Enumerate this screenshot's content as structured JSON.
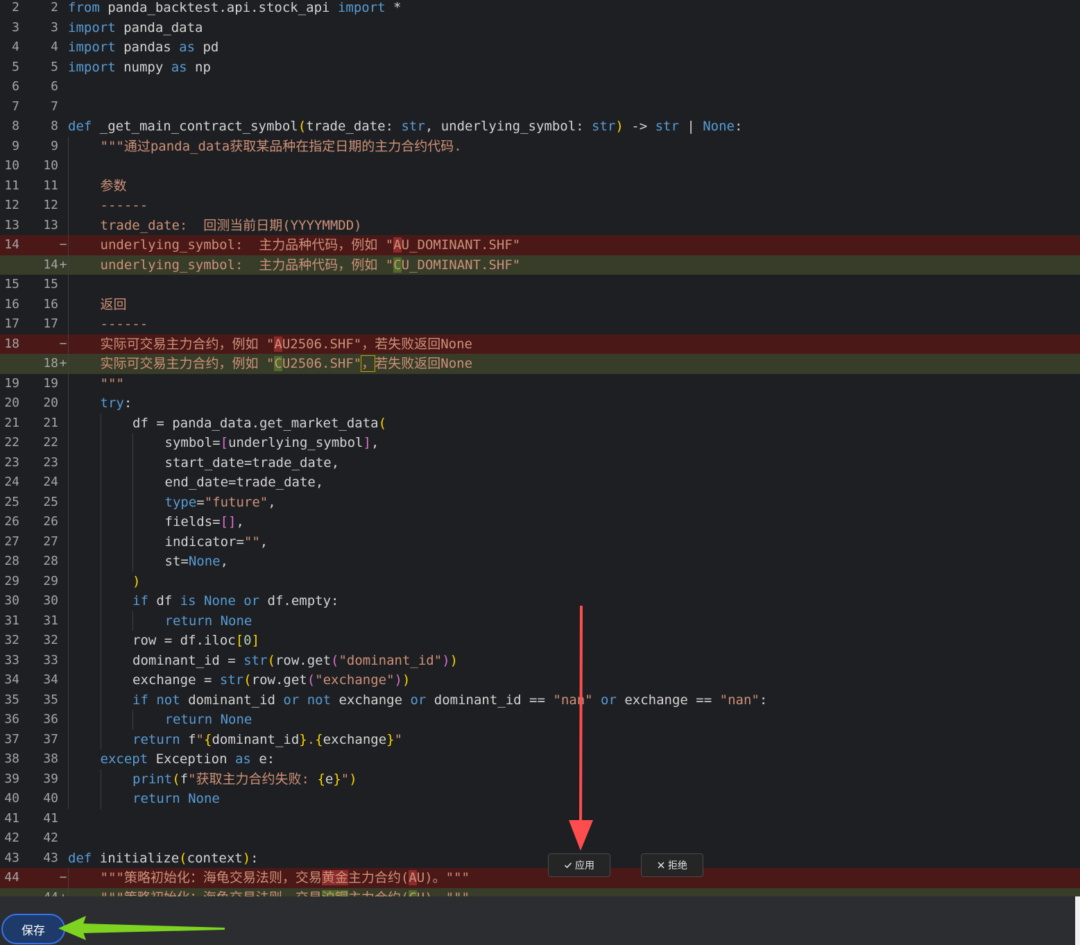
{
  "editor": {
    "lines": [
      {
        "old": "2",
        "new": "2",
        "mark": "",
        "type": "ctx",
        "indent": 0,
        "tokens": [
          [
            "from",
            "kw"
          ],
          [
            " panda_backtest.api.stock_api ",
            ""
          ],
          [
            "import",
            "kw"
          ],
          [
            " *",
            ""
          ]
        ]
      },
      {
        "old": "3",
        "new": "3",
        "mark": "",
        "type": "ctx",
        "indent": 0,
        "tokens": [
          [
            "import",
            "kw"
          ],
          [
            " panda_data",
            ""
          ]
        ]
      },
      {
        "old": "4",
        "new": "4",
        "mark": "",
        "type": "ctx",
        "indent": 0,
        "tokens": [
          [
            "import",
            "kw"
          ],
          [
            " pandas ",
            ""
          ],
          [
            "as",
            "kw"
          ],
          [
            " pd",
            ""
          ]
        ]
      },
      {
        "old": "5",
        "new": "5",
        "mark": "",
        "type": "ctx",
        "indent": 0,
        "tokens": [
          [
            "import",
            "kw"
          ],
          [
            " numpy ",
            ""
          ],
          [
            "as",
            "kw"
          ],
          [
            " np",
            ""
          ]
        ]
      },
      {
        "old": "6",
        "new": "6",
        "mark": "",
        "type": "ctx",
        "indent": 0,
        "tokens": []
      },
      {
        "old": "7",
        "new": "7",
        "mark": "",
        "type": "ctx",
        "indent": 0,
        "tokens": []
      },
      {
        "old": "8",
        "new": "8",
        "mark": "",
        "type": "ctx",
        "indent": 0,
        "tokens": [
          [
            "def",
            "kw"
          ],
          [
            " _get_main_contract_symbol",
            ""
          ],
          [
            "(",
            "br1"
          ],
          [
            "trade_date: ",
            ""
          ],
          [
            "str",
            "kw"
          ],
          [
            ", underlying_symbol: ",
            ""
          ],
          [
            "str",
            "kw"
          ],
          [
            ")",
            "br1"
          ],
          [
            " -> ",
            ""
          ],
          [
            "str",
            "kw"
          ],
          [
            " | ",
            ""
          ],
          [
            "None",
            "kw"
          ],
          [
            ":",
            ""
          ]
        ]
      },
      {
        "old": "9",
        "new": "9",
        "mark": "",
        "type": "ctx",
        "indent": 1,
        "tokens": [
          [
            "\"\"\"通过panda_data获取某品种在指定日期的主力合约代码.",
            "doc"
          ]
        ]
      },
      {
        "old": "10",
        "new": "10",
        "mark": "",
        "type": "ctx",
        "indent": 1,
        "tokens": []
      },
      {
        "old": "11",
        "new": "11",
        "mark": "",
        "type": "ctx",
        "indent": 1,
        "tokens": [
          [
            "参数",
            "doc"
          ]
        ]
      },
      {
        "old": "12",
        "new": "12",
        "mark": "",
        "type": "ctx",
        "indent": 1,
        "tokens": [
          [
            "------",
            "doc"
          ]
        ]
      },
      {
        "old": "13",
        "new": "13",
        "mark": "",
        "type": "ctx",
        "indent": 1,
        "tokens": [
          [
            "trade_date:  回测当前日期(YYYYMMDD)",
            "doc"
          ]
        ]
      },
      {
        "old": "14",
        "new": "",
        "mark": "−",
        "type": "del",
        "indent": 1,
        "tokens": [
          [
            "underlying_symbol:  主力品种代码，例如 \"",
            "doc"
          ],
          [
            "A",
            "doc hl-del"
          ],
          [
            "U_DOMINANT.SHF\"",
            "doc"
          ]
        ]
      },
      {
        "old": "",
        "new": "14",
        "mark": "+",
        "type": "add",
        "indent": 1,
        "tokens": [
          [
            "underlying_symbol:  主力品种代码，例如 \"",
            "doc"
          ],
          [
            "C",
            "doc hl-add"
          ],
          [
            "U_DOMINANT.SHF\"",
            "doc"
          ]
        ]
      },
      {
        "old": "15",
        "new": "15",
        "mark": "",
        "type": "ctx",
        "indent": 1,
        "tokens": []
      },
      {
        "old": "16",
        "new": "16",
        "mark": "",
        "type": "ctx",
        "indent": 1,
        "tokens": [
          [
            "返回",
            "doc"
          ]
        ]
      },
      {
        "old": "17",
        "new": "17",
        "mark": "",
        "type": "ctx",
        "indent": 1,
        "tokens": [
          [
            "------",
            "doc"
          ]
        ]
      },
      {
        "old": "18",
        "new": "",
        "mark": "−",
        "type": "del",
        "indent": 1,
        "tokens": [
          [
            "实际可交易主力合约，例如 \"",
            "doc"
          ],
          [
            "A",
            "doc hl-del"
          ],
          [
            "U2506.SHF\"，若失败返回None",
            "doc"
          ]
        ]
      },
      {
        "old": "",
        "new": "18",
        "mark": "+",
        "type": "add",
        "indent": 1,
        "tokens": [
          [
            "实际可交易主力合约，例如 \"",
            "doc"
          ],
          [
            "C",
            "doc hl-add"
          ],
          [
            "U2506.SHF\"",
            "doc"
          ],
          [
            "，",
            "doc hl-box"
          ],
          [
            "若失败返回None",
            "doc"
          ]
        ]
      },
      {
        "old": "19",
        "new": "19",
        "mark": "",
        "type": "ctx",
        "indent": 1,
        "tokens": [
          [
            "\"\"\"",
            "doc"
          ]
        ]
      },
      {
        "old": "20",
        "new": "20",
        "mark": "",
        "type": "ctx",
        "indent": 1,
        "tokens": [
          [
            "try",
            "kw"
          ],
          [
            ":",
            ""
          ]
        ]
      },
      {
        "old": "21",
        "new": "21",
        "mark": "",
        "type": "ctx",
        "indent": 2,
        "tokens": [
          [
            "df = panda_data.get_market_data",
            ""
          ],
          [
            "(",
            "br1"
          ]
        ]
      },
      {
        "old": "22",
        "new": "22",
        "mark": "",
        "type": "ctx",
        "indent": 3,
        "tokens": [
          [
            "symbol=",
            ""
          ],
          [
            "[",
            "br2"
          ],
          [
            "underlying_symbol",
            ""
          ],
          [
            "]",
            "br2"
          ],
          [
            ",",
            ""
          ]
        ]
      },
      {
        "old": "23",
        "new": "23",
        "mark": "",
        "type": "ctx",
        "indent": 3,
        "tokens": [
          [
            "start_date=trade_date,",
            ""
          ]
        ]
      },
      {
        "old": "24",
        "new": "24",
        "mark": "",
        "type": "ctx",
        "indent": 3,
        "tokens": [
          [
            "end_date=trade_date,",
            ""
          ]
        ]
      },
      {
        "old": "25",
        "new": "25",
        "mark": "",
        "type": "ctx",
        "indent": 3,
        "tokens": [
          [
            "type",
            "kw"
          ],
          [
            "=",
            ""
          ],
          [
            "\"future\"",
            "str"
          ],
          [
            ",",
            ""
          ]
        ]
      },
      {
        "old": "26",
        "new": "26",
        "mark": "",
        "type": "ctx",
        "indent": 3,
        "tokens": [
          [
            "fields=",
            ""
          ],
          [
            "[]",
            "br2"
          ],
          [
            ",",
            ""
          ]
        ]
      },
      {
        "old": "27",
        "new": "27",
        "mark": "",
        "type": "ctx",
        "indent": 3,
        "tokens": [
          [
            "indicator=",
            ""
          ],
          [
            "\"\"",
            "str"
          ],
          [
            ",",
            ""
          ]
        ]
      },
      {
        "old": "28",
        "new": "28",
        "mark": "",
        "type": "ctx",
        "indent": 3,
        "tokens": [
          [
            "st=",
            ""
          ],
          [
            "None",
            "kw"
          ],
          [
            ",",
            ""
          ]
        ]
      },
      {
        "old": "29",
        "new": "29",
        "mark": "",
        "type": "ctx",
        "indent": 2,
        "tokens": [
          [
            ")",
            "br1"
          ]
        ]
      },
      {
        "old": "30",
        "new": "30",
        "mark": "",
        "type": "ctx",
        "indent": 2,
        "tokens": [
          [
            "if",
            "kw"
          ],
          [
            " df ",
            ""
          ],
          [
            "is",
            "kw"
          ],
          [
            " ",
            ""
          ],
          [
            "None",
            "kw"
          ],
          [
            " ",
            ""
          ],
          [
            "or",
            "kw"
          ],
          [
            " df.empty:",
            ""
          ]
        ]
      },
      {
        "old": "31",
        "new": "31",
        "mark": "",
        "type": "ctx",
        "indent": 3,
        "tokens": [
          [
            "return",
            "kw"
          ],
          [
            " ",
            ""
          ],
          [
            "None",
            "kw"
          ]
        ]
      },
      {
        "old": "32",
        "new": "32",
        "mark": "",
        "type": "ctx",
        "indent": 2,
        "tokens": [
          [
            "row = df.iloc",
            ""
          ],
          [
            "[",
            "br1"
          ],
          [
            "0",
            "num"
          ],
          [
            "]",
            "br1"
          ]
        ]
      },
      {
        "old": "33",
        "new": "33",
        "mark": "",
        "type": "ctx",
        "indent": 2,
        "tokens": [
          [
            "dominant_id = ",
            ""
          ],
          [
            "str",
            "kw"
          ],
          [
            "(",
            "br1"
          ],
          [
            "row.get",
            ""
          ],
          [
            "(",
            "br2"
          ],
          [
            "\"dominant_id\"",
            "str"
          ],
          [
            ")",
            "br2"
          ],
          [
            ")",
            "br1"
          ]
        ]
      },
      {
        "old": "34",
        "new": "34",
        "mark": "",
        "type": "ctx",
        "indent": 2,
        "tokens": [
          [
            "exchange = ",
            ""
          ],
          [
            "str",
            "kw"
          ],
          [
            "(",
            "br1"
          ],
          [
            "row.get",
            ""
          ],
          [
            "(",
            "br2"
          ],
          [
            "\"exchange\"",
            "str"
          ],
          [
            ")",
            "br2"
          ],
          [
            ")",
            "br1"
          ]
        ]
      },
      {
        "old": "35",
        "new": "35",
        "mark": "",
        "type": "ctx",
        "indent": 2,
        "tokens": [
          [
            "if",
            "kw"
          ],
          [
            " ",
            ""
          ],
          [
            "not",
            "kw"
          ],
          [
            " dominant_id ",
            ""
          ],
          [
            "or",
            "kw"
          ],
          [
            " ",
            ""
          ],
          [
            "not",
            "kw"
          ],
          [
            " exchange ",
            ""
          ],
          [
            "or",
            "kw"
          ],
          [
            " dominant_id == ",
            ""
          ],
          [
            "\"nan\"",
            "str"
          ],
          [
            " ",
            ""
          ],
          [
            "or",
            "kw"
          ],
          [
            " exchange == ",
            ""
          ],
          [
            "\"nan\"",
            "str"
          ],
          [
            ":",
            ""
          ]
        ]
      },
      {
        "old": "36",
        "new": "36",
        "mark": "",
        "type": "ctx",
        "indent": 3,
        "tokens": [
          [
            "return",
            "kw"
          ],
          [
            " ",
            ""
          ],
          [
            "None",
            "kw"
          ]
        ]
      },
      {
        "old": "37",
        "new": "37",
        "mark": "",
        "type": "ctx",
        "indent": 2,
        "tokens": [
          [
            "return",
            "kw"
          ],
          [
            " f",
            ""
          ],
          [
            "\"",
            "str"
          ],
          [
            "{",
            "br1"
          ],
          [
            "dominant_id",
            ""
          ],
          [
            "}",
            "br1"
          ],
          [
            ".",
            "str"
          ],
          [
            "{",
            "br1"
          ],
          [
            "exchange",
            ""
          ],
          [
            "}",
            "br1"
          ],
          [
            "\"",
            "str"
          ]
        ]
      },
      {
        "old": "38",
        "new": "38",
        "mark": "",
        "type": "ctx",
        "indent": 1,
        "tokens": [
          [
            "except",
            "kw"
          ],
          [
            " Exception ",
            ""
          ],
          [
            "as",
            "kw"
          ],
          [
            " e:",
            ""
          ]
        ]
      },
      {
        "old": "39",
        "new": "39",
        "mark": "",
        "type": "ctx",
        "indent": 2,
        "tokens": [
          [
            "print",
            "kw"
          ],
          [
            "(",
            "br1"
          ],
          [
            "f",
            ""
          ],
          [
            "\"获取主力合约失败: ",
            "str"
          ],
          [
            "{",
            "br1"
          ],
          [
            "e",
            ""
          ],
          [
            "}",
            "br1"
          ],
          [
            "\"",
            "str"
          ],
          [
            ")",
            "br1"
          ]
        ]
      },
      {
        "old": "40",
        "new": "40",
        "mark": "",
        "type": "ctx",
        "indent": 2,
        "tokens": [
          [
            "return",
            "kw"
          ],
          [
            " ",
            ""
          ],
          [
            "None",
            "kw"
          ]
        ]
      },
      {
        "old": "41",
        "new": "41",
        "mark": "",
        "type": "ctx",
        "indent": 0,
        "tokens": []
      },
      {
        "old": "42",
        "new": "42",
        "mark": "",
        "type": "ctx",
        "indent": 0,
        "tokens": []
      },
      {
        "old": "43",
        "new": "43",
        "mark": "",
        "type": "ctx",
        "indent": 0,
        "tokens": [
          [
            "def",
            "kw"
          ],
          [
            " initialize",
            ""
          ],
          [
            "(",
            "br1"
          ],
          [
            "context",
            ""
          ],
          [
            ")",
            "br1"
          ],
          [
            ":",
            ""
          ]
        ]
      },
      {
        "old": "44",
        "new": "",
        "mark": "−",
        "type": "del",
        "indent": 1,
        "tokens": [
          [
            "\"\"\"策略初始化：海龟交易法则，交易",
            "doc"
          ],
          [
            "黄金",
            "doc hl-del"
          ],
          [
            "主力合约(",
            "doc"
          ],
          [
            "A",
            "doc hl-del"
          ],
          [
            "U)。\"\"\"",
            "doc"
          ]
        ]
      },
      {
        "old": "",
        "new": "44",
        "mark": "+",
        "type": "add",
        "indent": 1,
        "tokens": [
          [
            "\"\"\"策略初始化：海龟交易法则，交易",
            "doc"
          ],
          [
            "沪铜",
            "doc hl-add"
          ],
          [
            "主力合约(",
            "doc"
          ],
          [
            "C",
            "doc hl-add"
          ],
          [
            "U)。\"\"\"",
            "doc"
          ]
        ]
      }
    ]
  },
  "diff_actions": {
    "apply_label": "应用",
    "reject_label": "拒绝"
  },
  "footer": {
    "save_label": "保存"
  },
  "annotations": {
    "red_arrow_color": "#ff4d4d",
    "green_arrow_color": "#7ed321"
  }
}
